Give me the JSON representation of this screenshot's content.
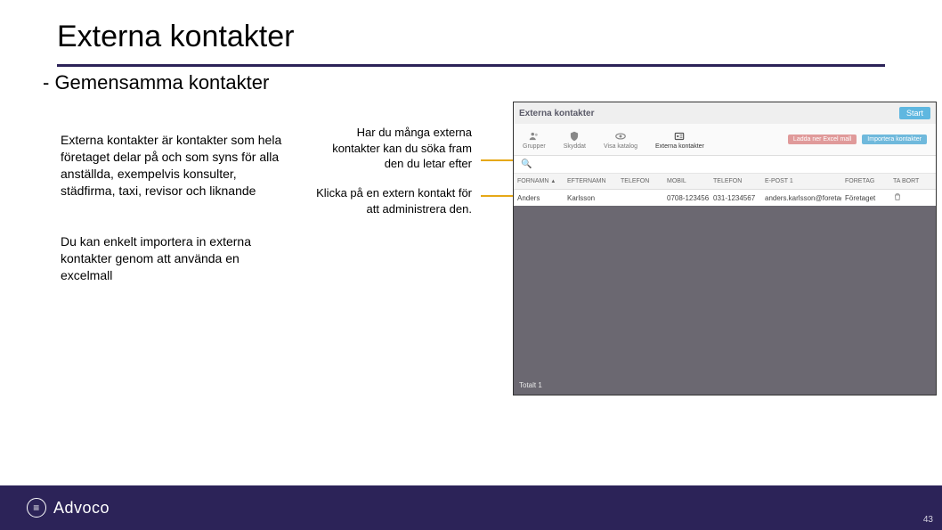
{
  "slide": {
    "title": "Externa kontakter",
    "subtitle": "- Gemensamma kontakter",
    "paragraph1": "Externa kontakter är kontakter som hela företaget delar på och som syns för alla anställda, exempelvis konsulter, städfirma, taxi, revisor och liknande",
    "paragraph2": "Du kan enkelt importera in externa kontakter genom att använda en excelmall",
    "note1": "Har du många externa kontakter kan du söka fram den du letar efter",
    "note2": "Klicka på en extern kontakt för att administrera den."
  },
  "screenshot": {
    "window_title": "Externa kontakter",
    "start_button": "Start",
    "tabs": [
      {
        "icon": "users",
        "label": "Grupper"
      },
      {
        "icon": "shield",
        "label": "Skyddat"
      },
      {
        "icon": "eye",
        "label": "Visa katalog"
      },
      {
        "icon": "id",
        "label": "Externa kontakter"
      }
    ],
    "actions": {
      "download": "Ladda ner Excel mall",
      "import": "Importera kontakter"
    },
    "search_placeholder": "",
    "columns": [
      "FÖRNAMN",
      "EFTERNAMN",
      "TELEFON",
      "MOBIL",
      "TELEFON",
      "E-POST 1",
      "FÖRETAG",
      "TA BORT"
    ],
    "row": {
      "fornamn": "Anders",
      "efternamn": "Karlsson",
      "telefon1": "",
      "mobil": "0708-123456",
      "telefon2": "031-1234567",
      "epost": "anders.karlsson@foretaget.se",
      "foretag": "Företaget",
      "tabort": ""
    },
    "footer": "Totalt 1"
  },
  "brand": {
    "name": "Advoco",
    "page_number": "43"
  }
}
